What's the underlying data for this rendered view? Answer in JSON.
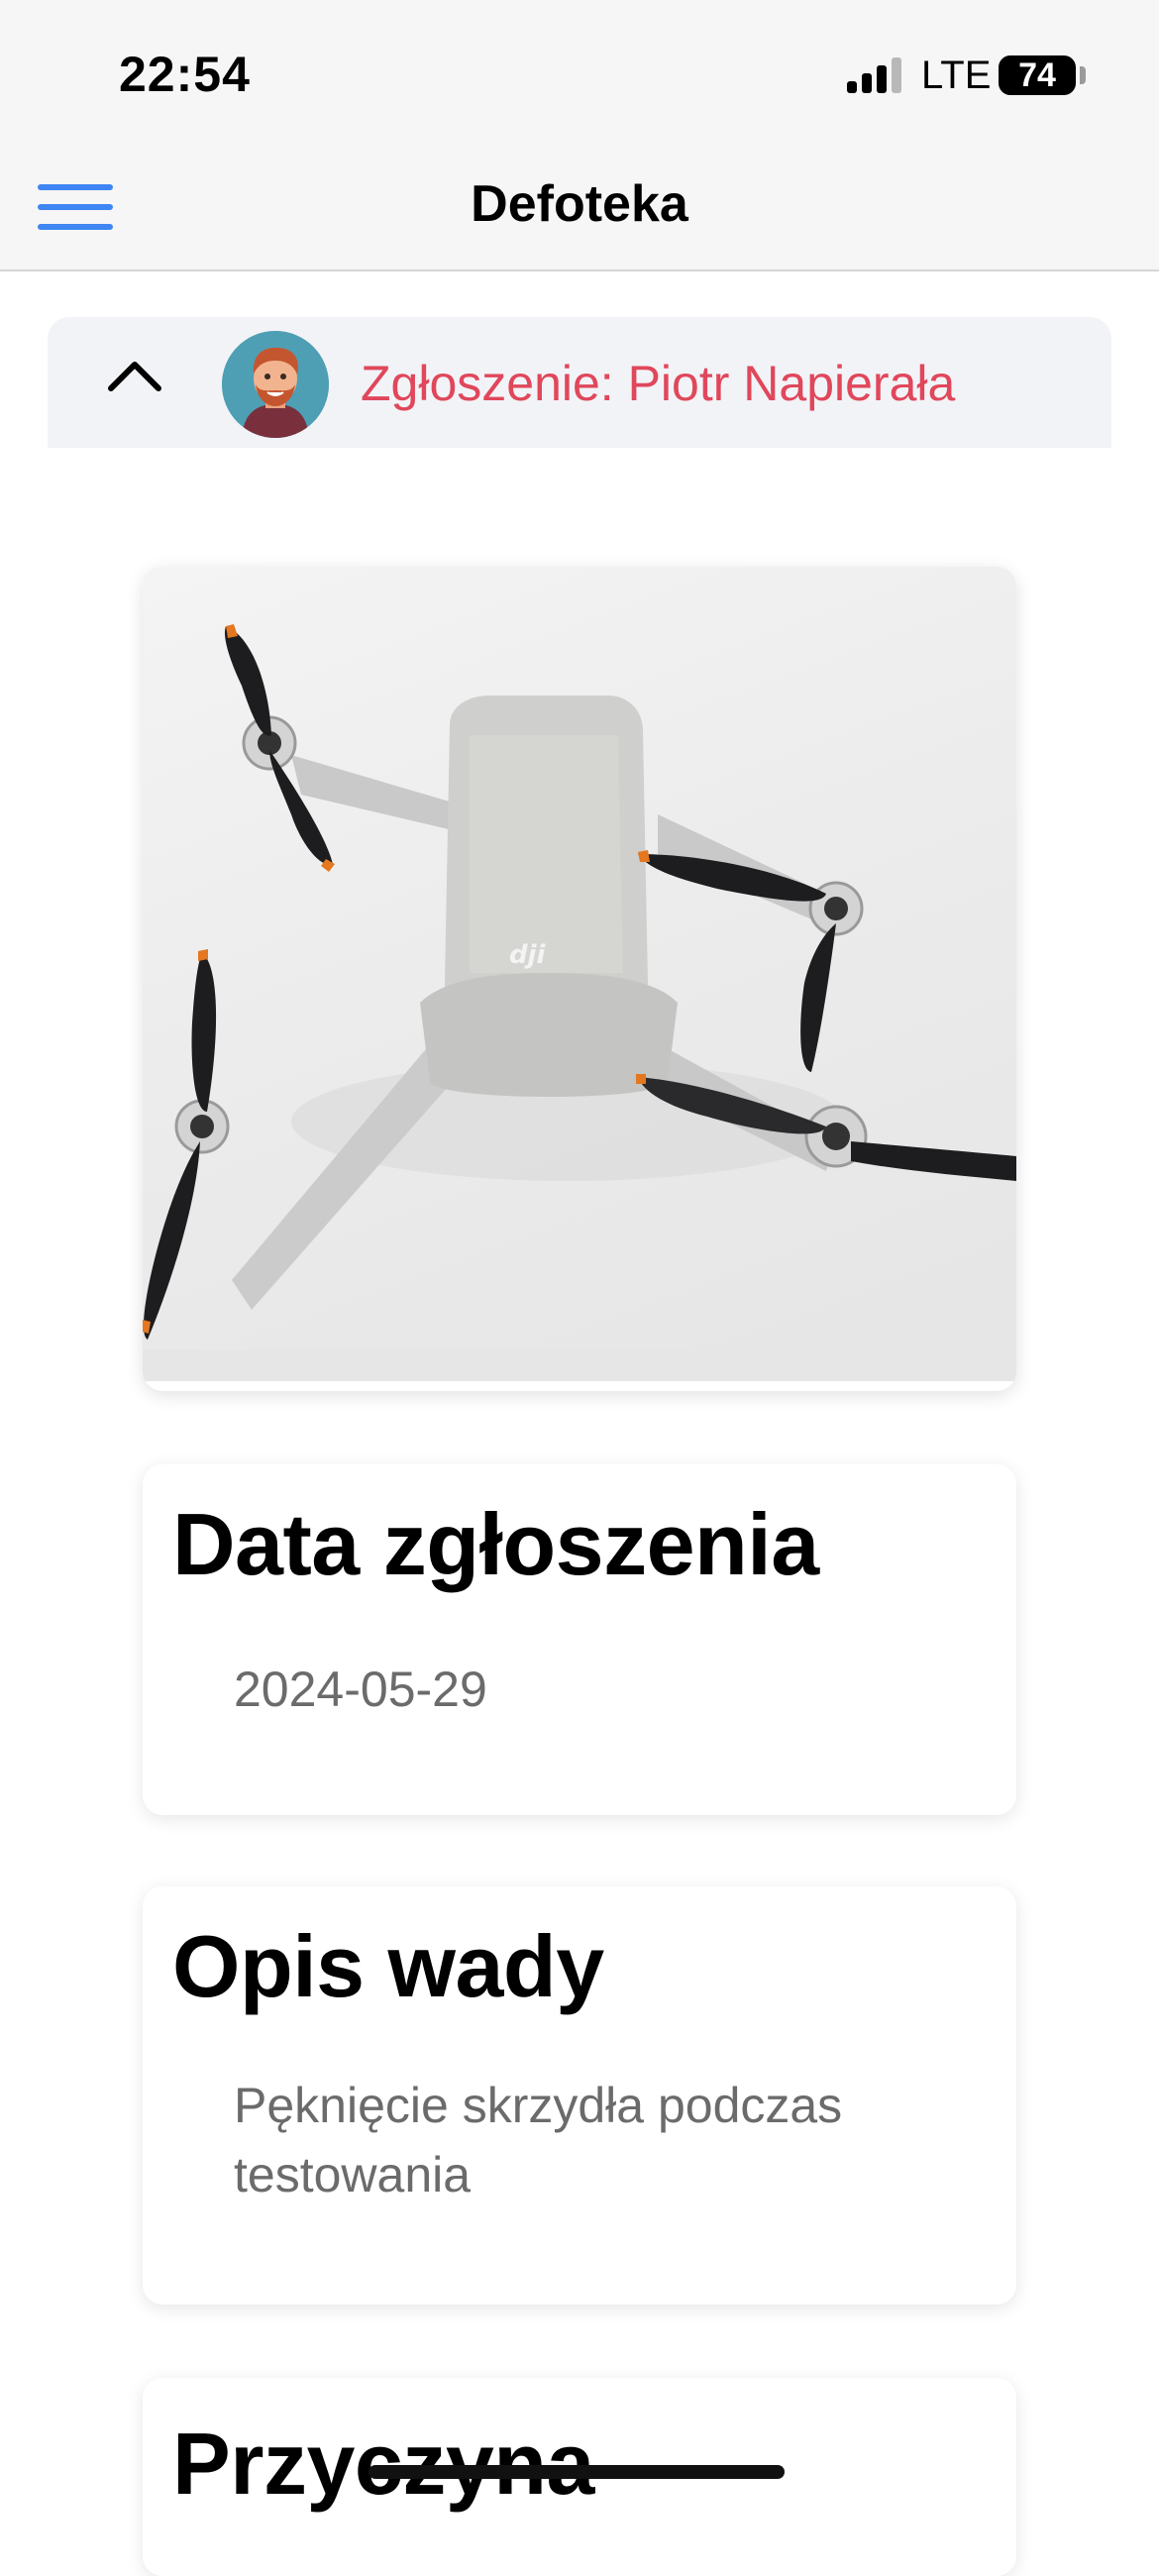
{
  "status_bar": {
    "time": "22:54",
    "network": "LTE",
    "battery": "74"
  },
  "navbar": {
    "title": "Defoteka",
    "menu_icon": "hamburger-menu-icon",
    "accent_color": "#3f86f4"
  },
  "reporter": {
    "label": "Zgłoszenie: Piotr Napierała",
    "label_color": "#e0475b",
    "toggle_icon": "chevron-up-icon"
  },
  "photo": {
    "alt": "dji"
  },
  "report_date": {
    "title": "Data zgłoszenia",
    "value": "2024-05-29"
  },
  "defect_description": {
    "title": "Opis wady",
    "value": "Pęknięcie skrzydła podczas testowania"
  },
  "cause": {
    "title": "Przyczyna"
  }
}
